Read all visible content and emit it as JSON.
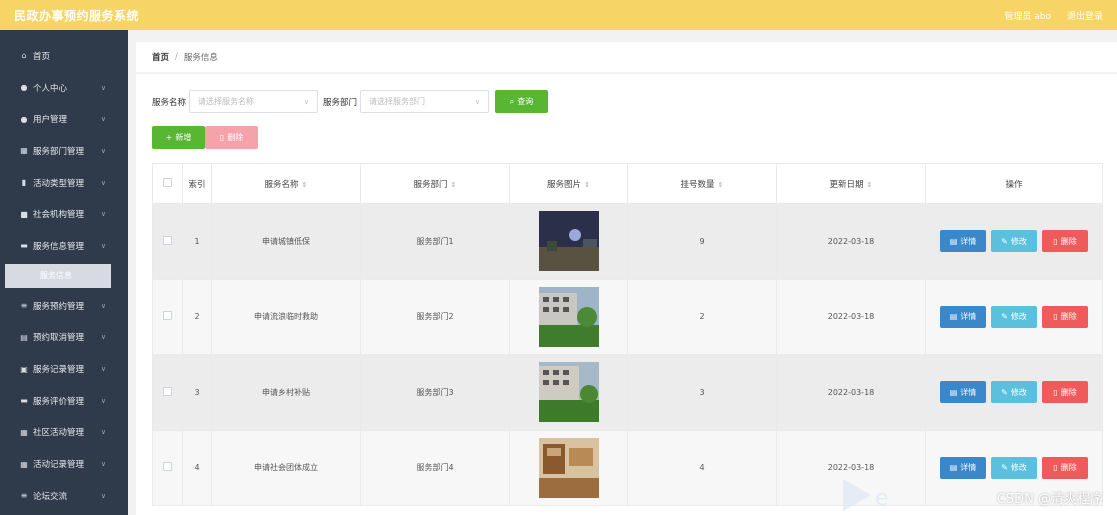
{
  "header": {
    "title": "民政办事预约服务系统",
    "user_label": "管理员 abo",
    "logout_label": "退出登录"
  },
  "sidebar": {
    "items": [
      {
        "label": "首页",
        "icon": "home-icon"
      },
      {
        "label": "个人中心",
        "icon": "user-icon"
      },
      {
        "label": "用户管理",
        "icon": "location-icon"
      },
      {
        "label": "服务部门管理",
        "icon": "grid-icon"
      },
      {
        "label": "活动类型管理",
        "icon": "bar-chart-icon"
      },
      {
        "label": "社会机构管理",
        "icon": "building-icon"
      },
      {
        "label": "服务信息管理",
        "icon": "comment-icon"
      },
      {
        "label": "服务预约管理",
        "icon": "list-icon"
      },
      {
        "label": "预约取消管理",
        "icon": "calendar-icon"
      },
      {
        "label": "服务记录管理",
        "icon": "archive-icon"
      },
      {
        "label": "服务评价管理",
        "icon": "keyboard-icon"
      },
      {
        "label": "社区活动管理",
        "icon": "grid-icon"
      },
      {
        "label": "活动记录管理",
        "icon": "grid-icon"
      },
      {
        "label": "论坛交流",
        "icon": "menu-icon"
      }
    ],
    "active_sub": "服务信息"
  },
  "breadcrumb": {
    "home": "首页",
    "current": "服务信息"
  },
  "filters": {
    "name_label": "服务名称",
    "name_placeholder": "请选择服务名称",
    "dept_label": "服务部门",
    "dept_placeholder": "请选择服务部门",
    "search_label": "查询"
  },
  "actions": {
    "add_label": "新增",
    "delete_label": "删除"
  },
  "table": {
    "headers": [
      "索引",
      "服务名称",
      "服务部门",
      "服务图片",
      "挂号数量",
      "更新日期",
      "操作"
    ],
    "rows": [
      {
        "index": "1",
        "name": "申请城镇低保",
        "dept": "服务部门1",
        "count": "9",
        "date": "2022-03-18",
        "image": "night-scene"
      },
      {
        "index": "2",
        "name": "申请流浪临时救助",
        "dept": "服务部门2",
        "count": "2",
        "date": "2022-03-18",
        "image": "building-garden"
      },
      {
        "index": "3",
        "name": "申请乡村补贴",
        "dept": "服务部门3",
        "count": "3",
        "date": "2022-03-18",
        "image": "building-garden"
      },
      {
        "index": "4",
        "name": "申请社会团体成立",
        "dept": "服务部门4",
        "count": "4",
        "date": "2022-03-18",
        "image": "room-interior"
      }
    ],
    "ops": {
      "detail": "详情",
      "edit": "修改",
      "delete": "删除"
    }
  },
  "watermark": "CSDN @清爽程序",
  "colors": {
    "header_bg": "#f7d466",
    "sidebar_bg": "#2f3a4a",
    "primary_green": "#59b633",
    "detail_blue": "#3a87c9",
    "edit_cyan": "#5bc0de",
    "delete_red": "#ef5a5a"
  }
}
